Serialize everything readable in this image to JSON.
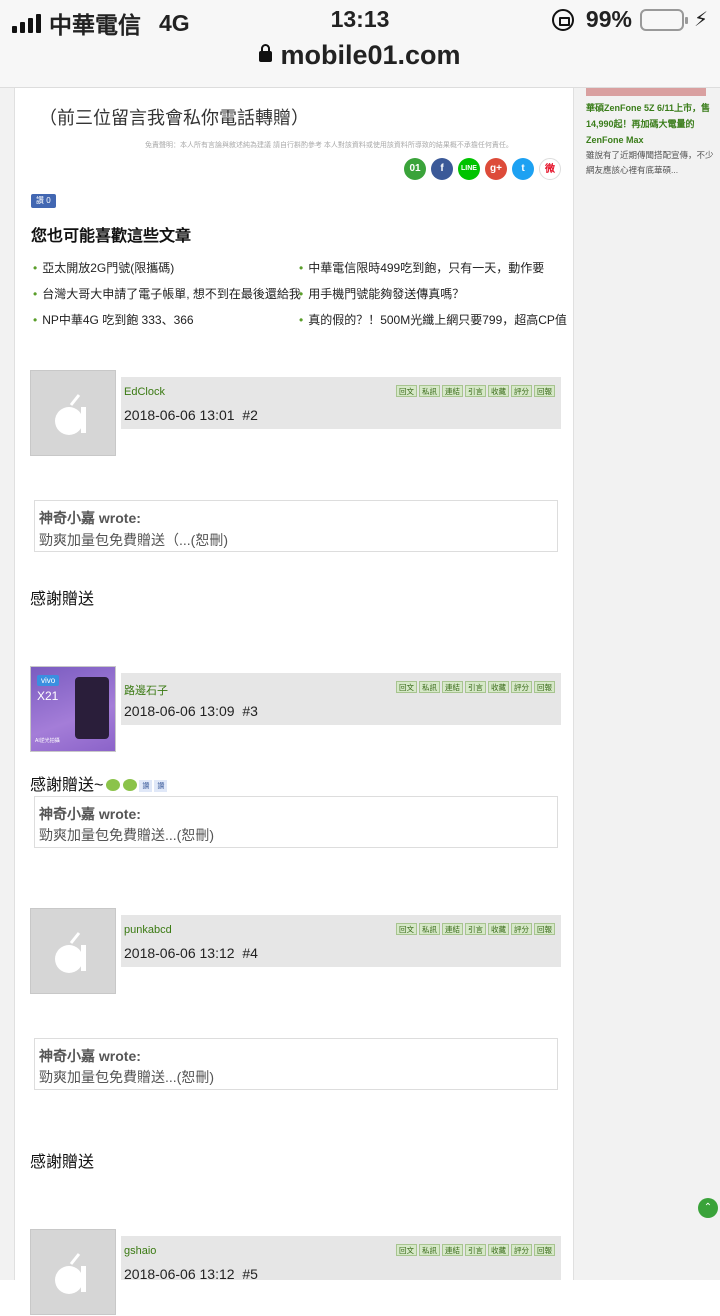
{
  "status": {
    "carrier": "中華電信",
    "network": "4G",
    "time": "13:13",
    "battery": "99%"
  },
  "browser": {
    "url": "mobile01.com"
  },
  "content": {
    "gift_note": "（前三位留言我會私你電話轉贈）",
    "disclaimer": "免責聲明：本人所有言論與敘述純為建議 請自行斟酌參考 本人對該資料或使用該資料所導致的結果概不承擔任何責任。",
    "share_icons": [
      "mobile01-icon",
      "facebook-icon",
      "line-icon",
      "google-plus-icon",
      "twitter-icon",
      "weibo-icon"
    ],
    "like_label": "讚 0",
    "related_title": "您也可能喜歡這些文章",
    "related": [
      "亞太開放2G門號(限攜碼)",
      "中華電信限時499吃到飽，只有一天，動作要",
      "台灣大哥大申請了電子帳單, 想不到在最後還給我",
      "用手機門號能夠發送傳真嗎？",
      "NP中華4G 吃到飽 333、366",
      "真的假的？！500M光纖上網只要799，超高CP值"
    ]
  },
  "sidebar": {
    "link": "華碩ZenFone 5Z 6/11上市，售14,990起！再加碼大電量的ZenFone Max",
    "desc": "雖說有了近期傳聞搭配宣傳，不少網友應該心裡有底華碩..."
  },
  "post_buttons": [
    "回文",
    "私訊",
    "連結",
    "引言",
    "收藏",
    "評分",
    "回報"
  ],
  "posts": [
    {
      "user": "EdClock",
      "date": "2018-06-06 13:01",
      "num": "#2",
      "quote_author": "神奇小嘉 wrote:",
      "quote_text": "勁爽加量包免費贈送（...(恕刪)",
      "reply": "感謝贈送"
    },
    {
      "user": "路邊石子",
      "date": "2018-06-06 13:09",
      "num": "#3",
      "reply": "感謝贈送~",
      "quote_author": "神奇小嘉 wrote:",
      "quote_text": "勁爽加量包免費贈送...(恕刪)",
      "avatar_brand": "vivo",
      "avatar_model": "X21",
      "avatar_caption": "AI逆光拍攝"
    },
    {
      "user": "punkabcd",
      "date": "2018-06-06 13:12",
      "num": "#4",
      "quote_author": "神奇小嘉 wrote:",
      "quote_text": "勁爽加量包免費贈送...(恕刪)",
      "reply": "感謝贈送"
    },
    {
      "user": "gshaio",
      "date": "2018-06-06 13:12",
      "num": "#5"
    }
  ],
  "emoji_chips": [
    "讚",
    "讚"
  ],
  "colors": {
    "accent": "#3a7a12",
    "share_green": "#3aa33a"
  }
}
